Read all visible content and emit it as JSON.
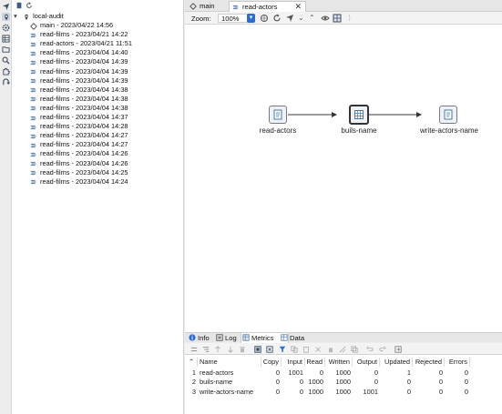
{
  "tree": {
    "root": "local-audit",
    "items": [
      {
        "label": "main - 2023/04/22 14:56",
        "type": "workflow"
      },
      {
        "label": "read-films - 2023/04/21 14:22",
        "type": "pipeline"
      },
      {
        "label": "read-actors - 2023/04/21 11:51",
        "type": "pipeline"
      },
      {
        "label": "read-films - 2023/04/04 14:40",
        "type": "pipeline"
      },
      {
        "label": "read-films - 2023/04/04 14:39",
        "type": "pipeline"
      },
      {
        "label": "read-films - 2023/04/04 14:39",
        "type": "pipeline"
      },
      {
        "label": "read-films - 2023/04/04 14:39",
        "type": "pipeline"
      },
      {
        "label": "read-films - 2023/04/04 14:38",
        "type": "pipeline"
      },
      {
        "label": "read-films - 2023/04/04 14:38",
        "type": "pipeline"
      },
      {
        "label": "read-films - 2023/04/04 14:38",
        "type": "pipeline"
      },
      {
        "label": "read-films - 2023/04/04 14:37",
        "type": "pipeline"
      },
      {
        "label": "read-films - 2023/04/04 14:28",
        "type": "pipeline"
      },
      {
        "label": "read-films - 2023/04/04 14:27",
        "type": "pipeline"
      },
      {
        "label": "read-films - 2023/04/04 14:27",
        "type": "pipeline"
      },
      {
        "label": "read-films - 2023/04/04 14:26",
        "type": "pipeline"
      },
      {
        "label": "read-films - 2023/04/04 14:26",
        "type": "pipeline"
      },
      {
        "label": "read-films - 2023/04/04 14:25",
        "type": "pipeline"
      },
      {
        "label": "read-films - 2023/04/04 14:24",
        "type": "pipeline"
      }
    ]
  },
  "tabs": [
    {
      "label": "main",
      "active": false
    },
    {
      "label": "read-actors",
      "active": true
    }
  ],
  "toolbar": {
    "zoom_label": "Zoom:",
    "zoom_value": "100%"
  },
  "pipeline": {
    "nodes": [
      {
        "label": "read-actors",
        "icon": "table-input-icon"
      },
      {
        "label": "buils-name",
        "icon": "calculator-icon"
      },
      {
        "label": "write-actors-name",
        "icon": "table-output-icon"
      }
    ]
  },
  "bottom_tabs": [
    {
      "label": "Info",
      "icon": "info-icon",
      "active": false
    },
    {
      "label": "Log",
      "icon": "log-icon",
      "active": false
    },
    {
      "label": "Metrics",
      "icon": "metrics-icon",
      "active": true
    },
    {
      "label": "Data",
      "icon": "data-icon",
      "active": false
    }
  ],
  "metrics": {
    "columns": [
      "Name",
      "Copy",
      "Input",
      "Read",
      "Written",
      "Output",
      "Updated",
      "Rejected",
      "Errors"
    ],
    "rows": [
      {
        "index": "1",
        "name": "read-actors",
        "copy": "0",
        "input": "1001",
        "read": "0",
        "written": "1000",
        "output": "0",
        "updated": "1",
        "rejected": "0",
        "errors": "0"
      },
      {
        "index": "2",
        "name": "buils-name",
        "copy": "0",
        "input": "0",
        "read": "1000",
        "written": "1000",
        "output": "0",
        "updated": "0",
        "rejected": "0",
        "errors": "0"
      },
      {
        "index": "3",
        "name": "write-actors-name",
        "copy": "0",
        "input": "0",
        "read": "1000",
        "written": "1000",
        "output": "1001",
        "updated": "0",
        "rejected": "0",
        "errors": "0"
      }
    ]
  },
  "colors": {
    "accent": "#2d6bd6",
    "pipeline_icon": "#4a7aa8",
    "panel_bg": "#ececec"
  }
}
